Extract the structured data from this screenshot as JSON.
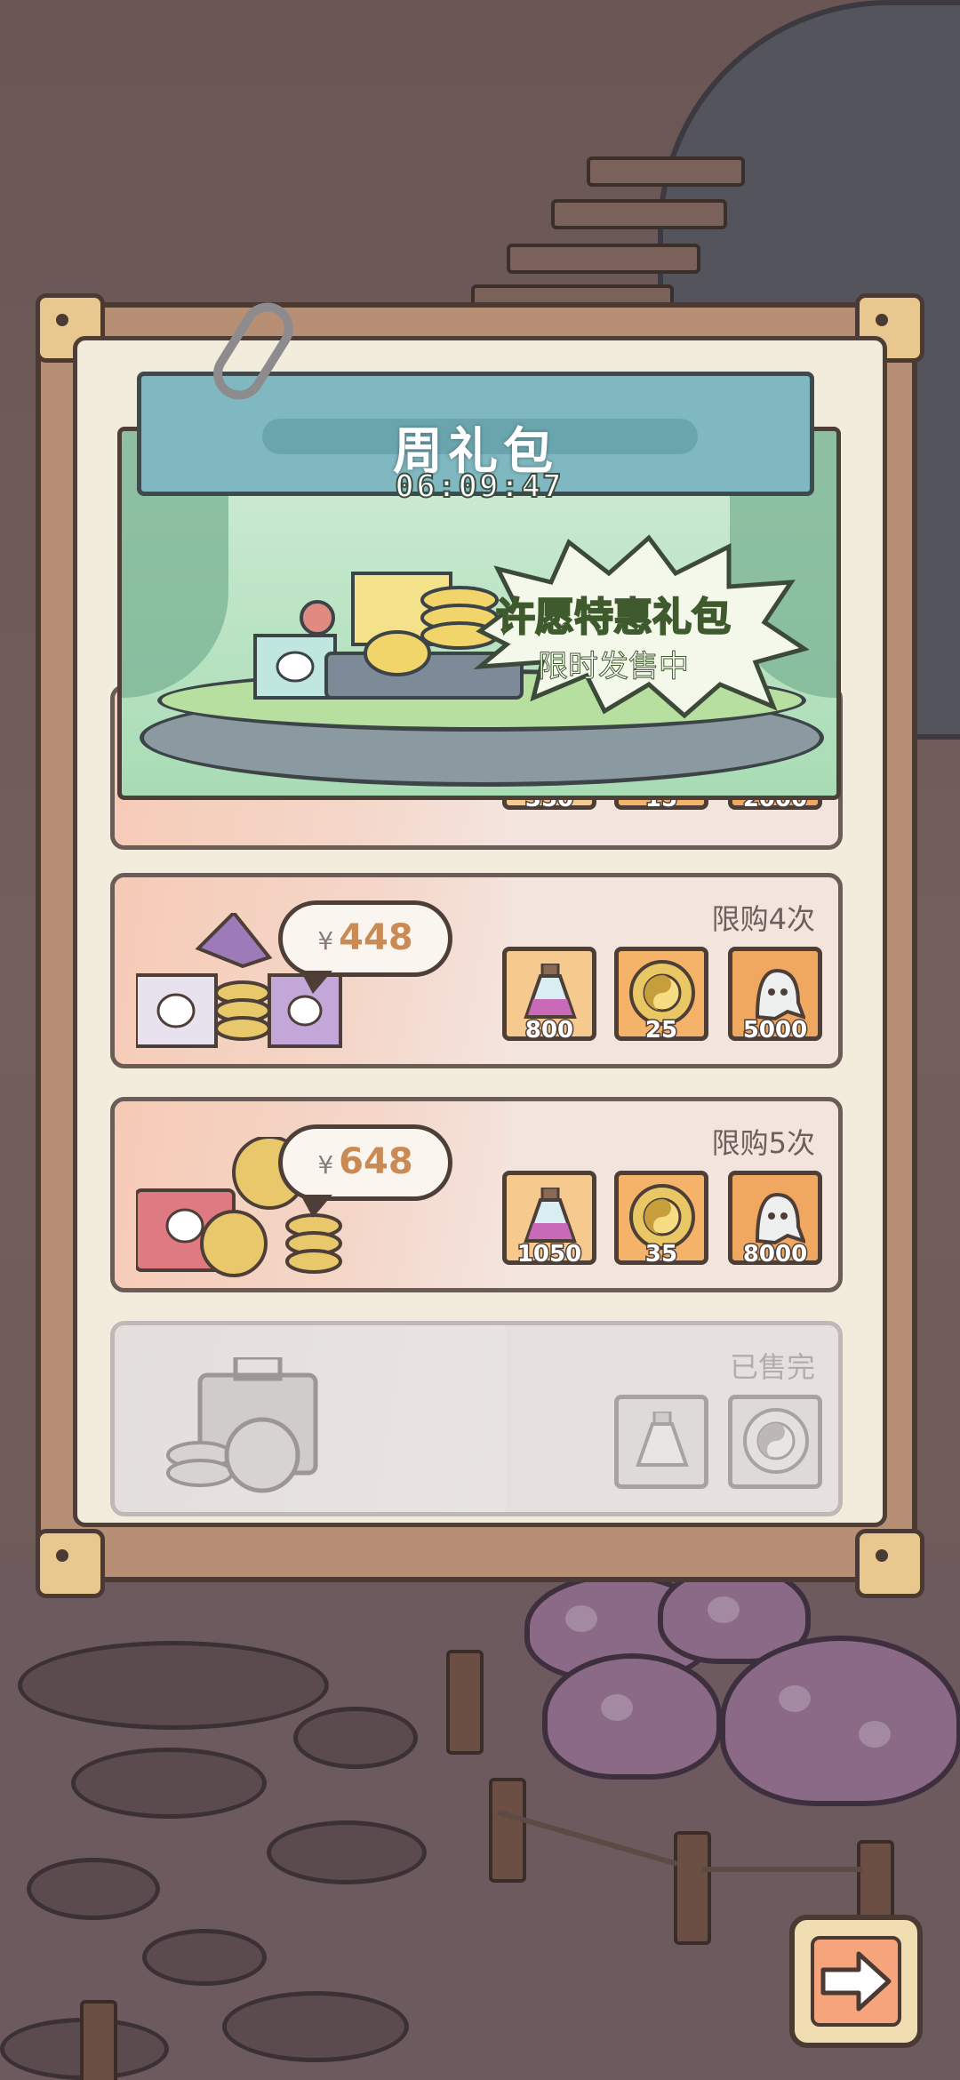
{
  "header": {
    "title": "周礼包",
    "timer": "06:09:47"
  },
  "banner": {
    "title": "许愿特惠礼包",
    "subtitle": "限时发售中"
  },
  "packs": [
    {
      "qty": [
        "350",
        "15",
        "2000"
      ]
    },
    {
      "currency": "¥",
      "price": "448",
      "limit": "限购4次",
      "qty": [
        "800",
        "25",
        "5000"
      ]
    },
    {
      "currency": "¥",
      "price": "648",
      "limit": "限购5次",
      "qty": [
        "1050",
        "35",
        "8000"
      ]
    },
    {
      "limit": "已售完"
    }
  ],
  "icons": {
    "item1": "potion-icon",
    "item2": "yin-yang-coin-icon",
    "item3": "ghost-icon",
    "next": "arrow-right-icon"
  },
  "colors": {
    "price": "#c98a55",
    "header": "#7fb8c0",
    "banner_text": "#98d45a"
  }
}
